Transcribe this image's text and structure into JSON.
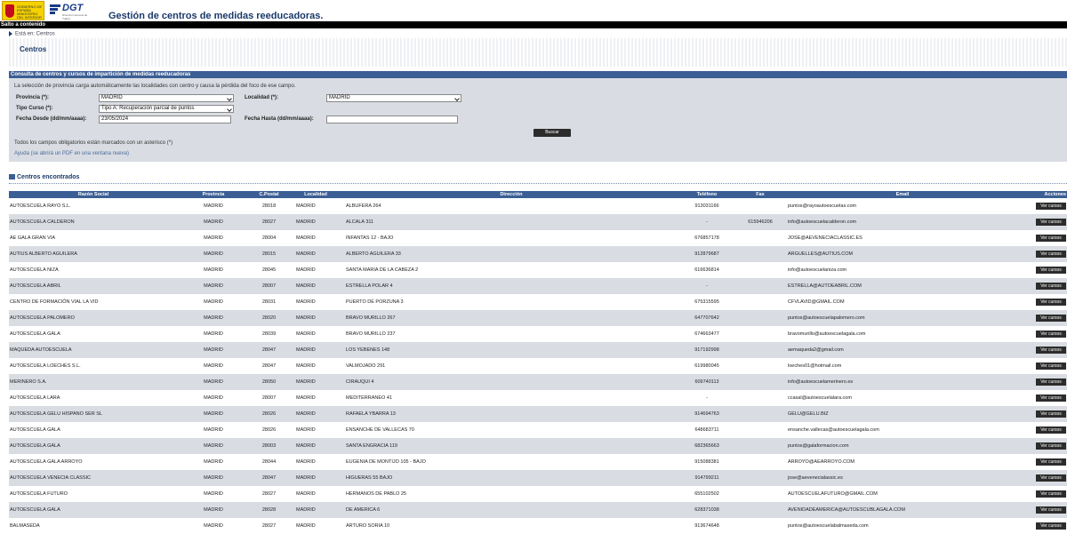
{
  "header": {
    "gob_logo_text": "GOBIERNO DE ESPAÑA MINISTERIO DEL INTERIOR",
    "dgt_logo_name": "DGT",
    "dgt_logo_sub": "Dirección General de Tráfico",
    "title": "Gestión de centros de medidas reeducadoras."
  },
  "skip_link": "Salto a contenido",
  "breadcrumb": "Está en: Centros",
  "page_title": "Centros",
  "search": {
    "panel_title": "Consulta de centros y cursos de impartición de medidas reeducadoras",
    "info": "La selección de provincia carga automáticamente las localidades con centro y causa la pérdida del foco de ese campo.",
    "provincia_label": "Provincia (*):",
    "provincia_value": "MADRID",
    "localidad_label": "Localidad (*):",
    "localidad_value": "MADRID",
    "tipo_label": "Tipo Curso (*):",
    "tipo_value": "Tipo A: Recuperación parcial de puntos",
    "fecha_desde_label": "Fecha Desde (dd/mm/aaaa):",
    "fecha_desde_value": "23/05/2024",
    "fecha_hasta_label": "Fecha Hasta (dd/mm/aaaa):",
    "fecha_hasta_value": "",
    "buscar_label": "Buscar",
    "mandatory_note": "Todos los campos obligatorios están marcados con un asterisco (*)",
    "help": "Ayuda (se abrirá un PDF en una ventana nueva)"
  },
  "results": {
    "title": "Centros encontrados",
    "columns": [
      "Razón Social",
      "Provincia",
      "C.Postal",
      "Localidad",
      "Dirección",
      "Teléfono",
      "Fax",
      "Email",
      "Acciones"
    ],
    "action_label": "Ver cursos",
    "rows": [
      [
        "AUTOESCUELA RAYO S.L.",
        "MADRID",
        "28018",
        "MADRID",
        "ALBUFERA 264",
        "913031166",
        "",
        "puntos@rayoautoescuelas.com"
      ],
      [
        "AUTOESCUELA CALDERON",
        "MADRID",
        "28027",
        "MADRID",
        "ALCALA 311",
        "-",
        "615946206",
        "info@autoescuelacalderon.com"
      ],
      [
        "AE GALA GRAN VIA",
        "MADRID",
        "28004",
        "MADRID",
        "INFANTAS 12 - BAJO",
        "676857178",
        "",
        "JOSE@AEVENECIACLASSIC.ES"
      ],
      [
        "AUTIUS ALBERTO AGUILERA",
        "MADRID",
        "28015",
        "MADRID",
        "ALBERTO AGUILERA 33",
        "912879687",
        "",
        "ARGUELLES@AUTIUS.COM"
      ],
      [
        "AUTOESCUELA NIZA",
        "MADRID",
        "28045",
        "MADRID",
        "SANTA MARIA DE LA CABEZA 2",
        "616636814",
        "",
        "info@autoescuelaniza.com"
      ],
      [
        "AUTOESCUELA ABRIL",
        "MADRID",
        "28007",
        "MADRID",
        "ESTRELLA POLAR 4",
        "-",
        "",
        "ESTRELLA@AUTOEABRIL.COM"
      ],
      [
        "CENTRO DE FORMACIÓN VIAL LA VID",
        "MADRID",
        "28031",
        "MADRID",
        "PUERTO DE PORZUNA 3",
        "675315595",
        "",
        "CFVLAVID@GMAIL.COM"
      ],
      [
        "AUTOESCUELA PALOMERO",
        "MADRID",
        "28020",
        "MADRID",
        "BRAVO MURILLO 267",
        "647707642",
        "",
        "puntos@autoescuelapalomero.com"
      ],
      [
        "AUTOESCUELA GALA",
        "MADRID",
        "28039",
        "MADRID",
        "BRAVO MURILLO 237",
        "674663477",
        "",
        "bravomurillo@autoescuelagala.com"
      ],
      [
        "MAQUEDA AUTOESCUELA",
        "MADRID",
        "28047",
        "MADRID",
        "LOS YEBENES 148",
        "917192998",
        "",
        "aemaqueda2@gmail.com"
      ],
      [
        "AUTOESCUELA LOECHES S.L.",
        "MADRID",
        "28047",
        "MADRID",
        "VALMOJADO 291",
        "619980045",
        "",
        "loeches01@hotmail.com"
      ],
      [
        "MERINERO S.A.",
        "MADRID",
        "28050",
        "MADRID",
        "CIRAUQUI 4",
        "609740113",
        "",
        "info@autoescuelamerinero.es"
      ],
      [
        "AUTOESCUELA LARA",
        "MADRID",
        "28007",
        "MADRID",
        "MEDITERRANEO 41",
        "-",
        "",
        "ccasal@autoescuelalara.com"
      ],
      [
        "AUTOESCUELA GELU HISPANO SER SL",
        "MADRID",
        "28026",
        "MADRID",
        "RAFAELA YBARRA 13",
        "914694763",
        "",
        "GELU@GELU.BIZ"
      ],
      [
        "AUTOESCUELA GALA",
        "MADRID",
        "28026",
        "MADRID",
        "ENSANCHE DE VALLECAS 70",
        "648683711",
        "",
        "ensanche.vallecas@autoescuelagala.com"
      ],
      [
        "AUTOESCUELA GALA",
        "MADRID",
        "28003",
        "MADRID",
        "SANTA ENGRACIA 119",
        "682365663",
        "",
        "puntos@galaformacion.com"
      ],
      [
        "AUTOESCUELA GALA ARROYO",
        "MADRID",
        "28044",
        "MADRID",
        "EUGENIA DE MONTIJO 105 - BAJO",
        "915088381",
        "",
        "ARROYO@AEARROYO.COM"
      ],
      [
        "AUTOESCUELA VENECIA CLASSIC",
        "MADRID",
        "28047",
        "MADRID",
        "HIGUERAS 55 BAJO",
        "914799211",
        "",
        "jose@aevenecialassic.es"
      ],
      [
        "AUTOESCUELA FUTURO",
        "MADRID",
        "28027",
        "MADRID",
        "HERMANOS DE PABLO 25",
        "655102502",
        "",
        "AUTOESCUELAFUTURO@GMAIL.COM"
      ],
      [
        "AUTOESCUELA GALA",
        "MADRID",
        "28028",
        "MADRID",
        "DE AMERICA 6",
        "628371038",
        "",
        "AVENIDADEAMERICA@AUTOESCUBLAGALA.COM"
      ],
      [
        "BALMASEDA",
        "MADRID",
        "28027",
        "MADRID",
        "ARTURO SORIA 10",
        "913674648",
        "",
        "puntos@autoescuelabalmaseda.com"
      ]
    ]
  }
}
